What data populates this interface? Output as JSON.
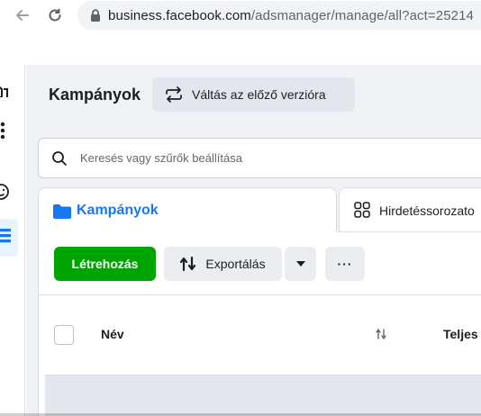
{
  "browser": {
    "url_host": "business.facebook.com",
    "url_path": "/adsmanager/manage/all?act=25214"
  },
  "header": {
    "title": "Kampányok",
    "switch_label": "Váltás az előző verzióra"
  },
  "search": {
    "placeholder": "Keresés vagy szűrők beállítása"
  },
  "tabs": [
    {
      "label": "Kampányok",
      "active": true
    },
    {
      "label": "Hirdetéssorozato",
      "active": false
    }
  ],
  "toolbar": {
    "create_label": "Létrehozás",
    "export_label": "Exportálás",
    "more_label": "···"
  },
  "table": {
    "columns": [
      "Név",
      "Teljes"
    ]
  },
  "colors": {
    "accent_blue": "#1877f2",
    "create_green": "#00a400"
  }
}
